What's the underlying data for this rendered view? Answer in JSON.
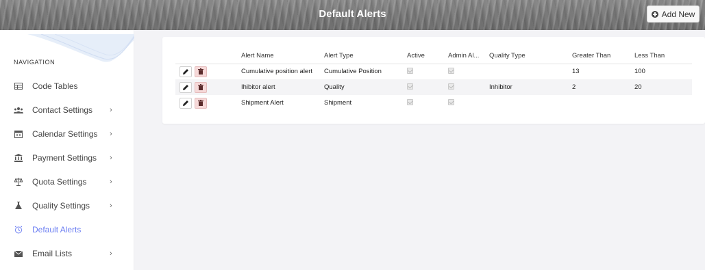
{
  "header": {
    "title": "Default Alerts",
    "add_new_label": "Add New"
  },
  "sidebar": {
    "heading": "NAVIGATION",
    "items": [
      {
        "label": "Code Tables",
        "icon": "table-icon",
        "has_chevron": false,
        "active": false
      },
      {
        "label": "Contact Settings",
        "icon": "people-icon",
        "has_chevron": true,
        "active": false
      },
      {
        "label": "Calendar Settings",
        "icon": "calendar-icon",
        "has_chevron": true,
        "active": false
      },
      {
        "label": "Payment Settings",
        "icon": "bank-icon",
        "has_chevron": true,
        "active": false
      },
      {
        "label": "Quota Settings",
        "icon": "scale-icon",
        "has_chevron": true,
        "active": false
      },
      {
        "label": "Quality Settings",
        "icon": "flask-icon",
        "has_chevron": true,
        "active": false
      },
      {
        "label": "Default Alerts",
        "icon": "alarm-clock-icon",
        "has_chevron": false,
        "active": true
      },
      {
        "label": "Email Lists",
        "icon": "envelope-icon",
        "has_chevron": true,
        "active": false
      }
    ],
    "chevron": "›"
  },
  "table": {
    "columns": [
      "",
      "Alert Name",
      "Alert Type",
      "Active",
      "Admin Al...",
      "Quality Type",
      "Greater Than",
      "Less Than"
    ],
    "rows": [
      {
        "name": "Cumulative position alert",
        "type": "Cumulative Position",
        "active": true,
        "admin": true,
        "quality_type": "",
        "greater_than": "13",
        "less_than": "100"
      },
      {
        "name": "Ihibitor alert",
        "type": "Quality",
        "active": true,
        "admin": true,
        "quality_type": "Inhibitor",
        "greater_than": "2",
        "less_than": "20"
      },
      {
        "name": "Shipment Alert",
        "type": "Shipment",
        "active": true,
        "admin": true,
        "quality_type": "",
        "greater_than": "",
        "less_than": ""
      }
    ]
  },
  "colors": {
    "accent": "#6b7ef2",
    "delete_bg": "#f6d9d9",
    "header_bg": "#7a7a7a"
  }
}
